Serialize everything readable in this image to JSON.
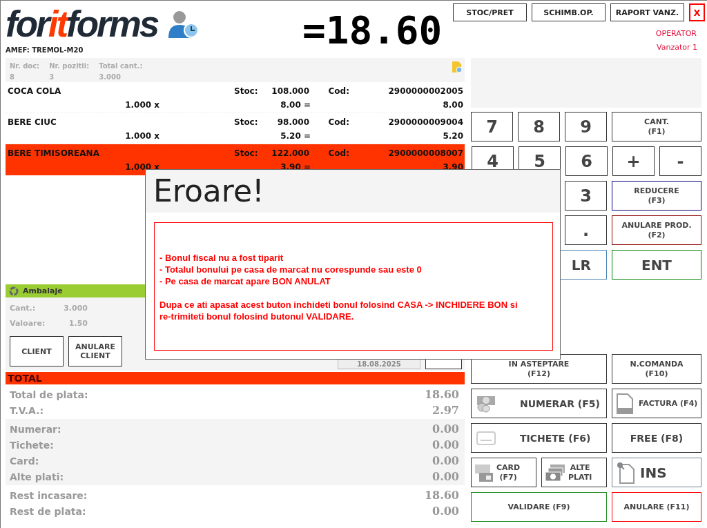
{
  "logo": {
    "parts": [
      {
        "text": "for",
        "accent": false
      },
      {
        "text": "it",
        "accent": true
      },
      {
        "text": "forms",
        "accent": false
      }
    ]
  },
  "device": "AMEF: TREMOL-M20",
  "amount": "=18.60",
  "top_buttons": [
    {
      "label": "STOC/PRET",
      "kind": "normal"
    },
    {
      "label": "SCHIMB.OP.",
      "kind": "normal"
    },
    {
      "label": "RAPORT VANZ.",
      "kind": "normal"
    },
    {
      "label": "X",
      "kind": "close"
    }
  ],
  "operator": {
    "title": "OPERATOR",
    "name": "Vanzator 1"
  },
  "document": {
    "fields": [
      {
        "label": "Nr. doc:",
        "value": "8"
      },
      {
        "label": "Nr. pozitii:",
        "value": "3"
      },
      {
        "label": "Total cant.:",
        "value": "3.000"
      }
    ]
  },
  "items": [
    {
      "name": "COCA COLA",
      "stock_label": "Stoc:",
      "stock": "108.000",
      "code_label": "Cod:",
      "code": "2900000002005",
      "quantity": "1.000 x",
      "price": "8.00 =",
      "total": "8.00",
      "selected": false
    },
    {
      "name": "BERE CIUC",
      "stock_label": "Stoc:",
      "stock": "98.000",
      "code_label": "Cod:",
      "code": "2900000009004",
      "quantity": "1.000 x",
      "price": "5.20 =",
      "total": "5.20",
      "selected": false
    },
    {
      "name": "BERE TIMISOREANA",
      "stock_label": "Stoc:",
      "stock": "122.000",
      "code_label": "Cod:",
      "code": "2900000008007",
      "quantity": "1.000 x",
      "price": "3.90 =",
      "total": "3.90",
      "selected": true
    }
  ],
  "packaging": {
    "title": "Ambalaje",
    "fields": [
      {
        "label": "Cant.:",
        "value": "3.000"
      },
      {
        "label": "Valoare:",
        "value": "1.50"
      }
    ],
    "buttons": [
      "CLIENT",
      "ANULARE\nCLIENT"
    ],
    "date": "18.08.2025"
  },
  "total": {
    "title": "TOTAL",
    "groups": [
      {
        "kind": "summary",
        "rows": [
          {
            "label": "Total de plata:",
            "value": "18.60"
          },
          {
            "label": "T.V.A.:",
            "value": "2.97"
          }
        ]
      },
      {
        "kind": "payments",
        "rows": [
          {
            "label": "Numerar:",
            "value": "0.00"
          },
          {
            "label": "Tichete:",
            "value": "0.00"
          },
          {
            "label": "Card:",
            "value": "0.00"
          },
          {
            "label": "Alte plati:",
            "value": "0.00"
          }
        ]
      },
      {
        "kind": "change",
        "rows": [
          {
            "label": "Rest incasare:",
            "value": "18.60"
          },
          {
            "label": "Rest de plata:",
            "value": "0.00"
          }
        ]
      }
    ]
  },
  "keypad": [
    [
      {
        "label": "7",
        "kind": "digit"
      },
      {
        "label": "8",
        "kind": "digit"
      },
      {
        "label": "9",
        "kind": "digit"
      },
      {
        "label": "CANT.\n(F1)",
        "kind": "function"
      }
    ],
    [
      {
        "label": "4",
        "kind": "digit"
      },
      {
        "label": "5",
        "kind": "digit"
      },
      {
        "label": "6",
        "kind": "digit"
      },
      {
        "label": "+",
        "kind": "digit"
      },
      {
        "label": "-",
        "kind": "digit"
      }
    ],
    [
      {
        "label": "3",
        "kind": "digit"
      },
      {
        "label": "REDUCERE\n(F3)",
        "kind": "function",
        "color": "#000080"
      }
    ],
    [
      {
        "label": ".",
        "kind": "digit"
      },
      {
        "label": "ANULARE PROD.\n(F2)",
        "kind": "function",
        "color": "#8b0000"
      }
    ],
    [
      {
        "label": "LR",
        "kind": "clear",
        "color": "#4682b4"
      },
      {
        "label": "ENT",
        "kind": "enter",
        "color": "#008000"
      }
    ]
  ],
  "actions": [
    [
      {
        "label": "IN ASTEPTARE\n(F12)",
        "kind": "hold"
      },
      {
        "label": "N.COMANDA\n(F10)",
        "kind": "function"
      }
    ],
    [
      {
        "label": "NUMERAR (F5)",
        "kind": "cash"
      },
      {
        "label": "FACTURA (F4)",
        "kind": "invoice"
      }
    ],
    [
      {
        "label": "TICHETE (F6)",
        "kind": "ticket"
      },
      {
        "label": "FREE (F8)",
        "kind": "free"
      }
    ],
    [
      {
        "label": "CARD\n(F7)",
        "kind": "card"
      },
      {
        "label": "ALTE\nPLATI",
        "kind": "bills"
      },
      {
        "label": "INS",
        "kind": "insert",
        "color": "#708090"
      }
    ],
    [
      {
        "label": "VALIDARE (F9)",
        "kind": "hold",
        "color": "#228b22"
      },
      {
        "label": "ANULARE (F11)",
        "kind": "function",
        "color": "#ff0000"
      }
    ]
  ],
  "dialog": {
    "title": "Eroare!",
    "lines": [
      "- Bonul fiscal nu a fost tiparit",
      "- Totalul bonului pe casa de marcat nu corespunde sau este 0",
      "- Pe casa de marcat apare BON ANULAT"
    ],
    "note": "Dupa ce ati apasat acest buton inchideti bonul folosind CASA -> INCHIDERE BON si re-trimiteti bonul folosind butonul VALIDARE."
  }
}
